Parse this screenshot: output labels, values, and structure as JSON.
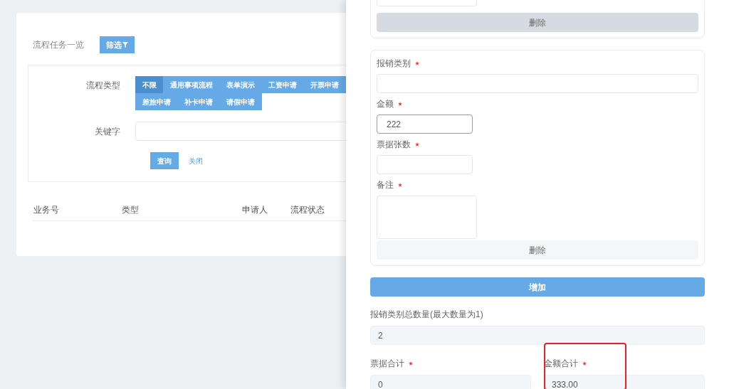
{
  "page": {
    "title": "流程任务一览",
    "filter_button": "筛选"
  },
  "filter_panel": {
    "process_type_label": "流程类型",
    "options": [
      {
        "label": "不限",
        "selected": true
      },
      {
        "label": "通用事项流程",
        "selected": false
      },
      {
        "label": "表单演示",
        "selected": false
      },
      {
        "label": "工资申请",
        "selected": false
      },
      {
        "label": "开票申请",
        "selected": false
      },
      {
        "label": "差旅申请",
        "selected": false
      },
      {
        "label": "补卡申请",
        "selected": false
      },
      {
        "label": "请假申请",
        "selected": false
      }
    ],
    "keyword_label": "关键字",
    "query_button": "查询",
    "close_link": "关闭"
  },
  "table": {
    "columns": [
      "业务号",
      "类型",
      "申请人",
      "流程状态"
    ]
  },
  "drawer": {
    "cards": [
      {
        "fields": [
          {
            "kind": "textarea"
          }
        ],
        "delete_button": "删除",
        "hovered": true
      },
      {
        "fields": [
          {
            "kind": "select",
            "label": "报销类别",
            "required": true
          },
          {
            "kind": "input",
            "label": "金额",
            "required": true,
            "value": "222",
            "focused": true
          },
          {
            "kind": "input",
            "label": "票据张数",
            "required": true,
            "focused": false
          },
          {
            "kind": "textarea",
            "label": "备注",
            "required": true
          }
        ],
        "delete_button": "删除",
        "hovered": false
      }
    ],
    "add_button": "增加",
    "count_field": {
      "label": "报销类别总数量(最大数量为1)",
      "value": "2"
    },
    "totals": [
      {
        "label": "票据合计",
        "required": true,
        "value": "0",
        "highlighted": false
      },
      {
        "label": "金额合计",
        "required": true,
        "value": "333.00",
        "highlighted": true
      }
    ]
  }
}
